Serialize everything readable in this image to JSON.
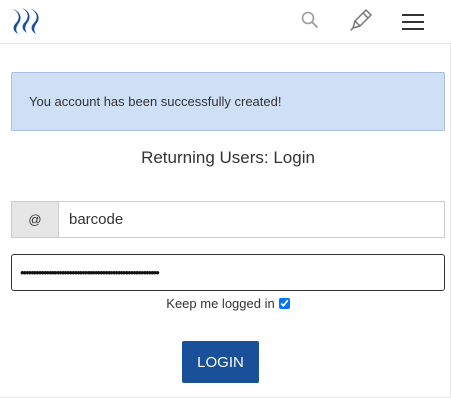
{
  "header": {
    "logo_icon": "steemit-logo-icon",
    "search_icon": "search-icon",
    "edit_icon": "pencil-icon",
    "menu_icon": "hamburger-menu-icon"
  },
  "alert": {
    "message": "You account has been successfully created!"
  },
  "login": {
    "heading": "Returning Users: Login",
    "username_prefix": "@",
    "username_value": "barcode",
    "password_value": "••••••••••••••••••••••••••••••••••••••••••••••••••••••",
    "keep_logged_in_label": "Keep me logged in",
    "keep_logged_in_checked": true,
    "login_button_label": "LOGIN"
  },
  "colors": {
    "accent": "#1a5099",
    "logo_blue": "#1a5099",
    "alert_bg": "#cfe0f6",
    "alert_border": "#a9bfdf"
  }
}
